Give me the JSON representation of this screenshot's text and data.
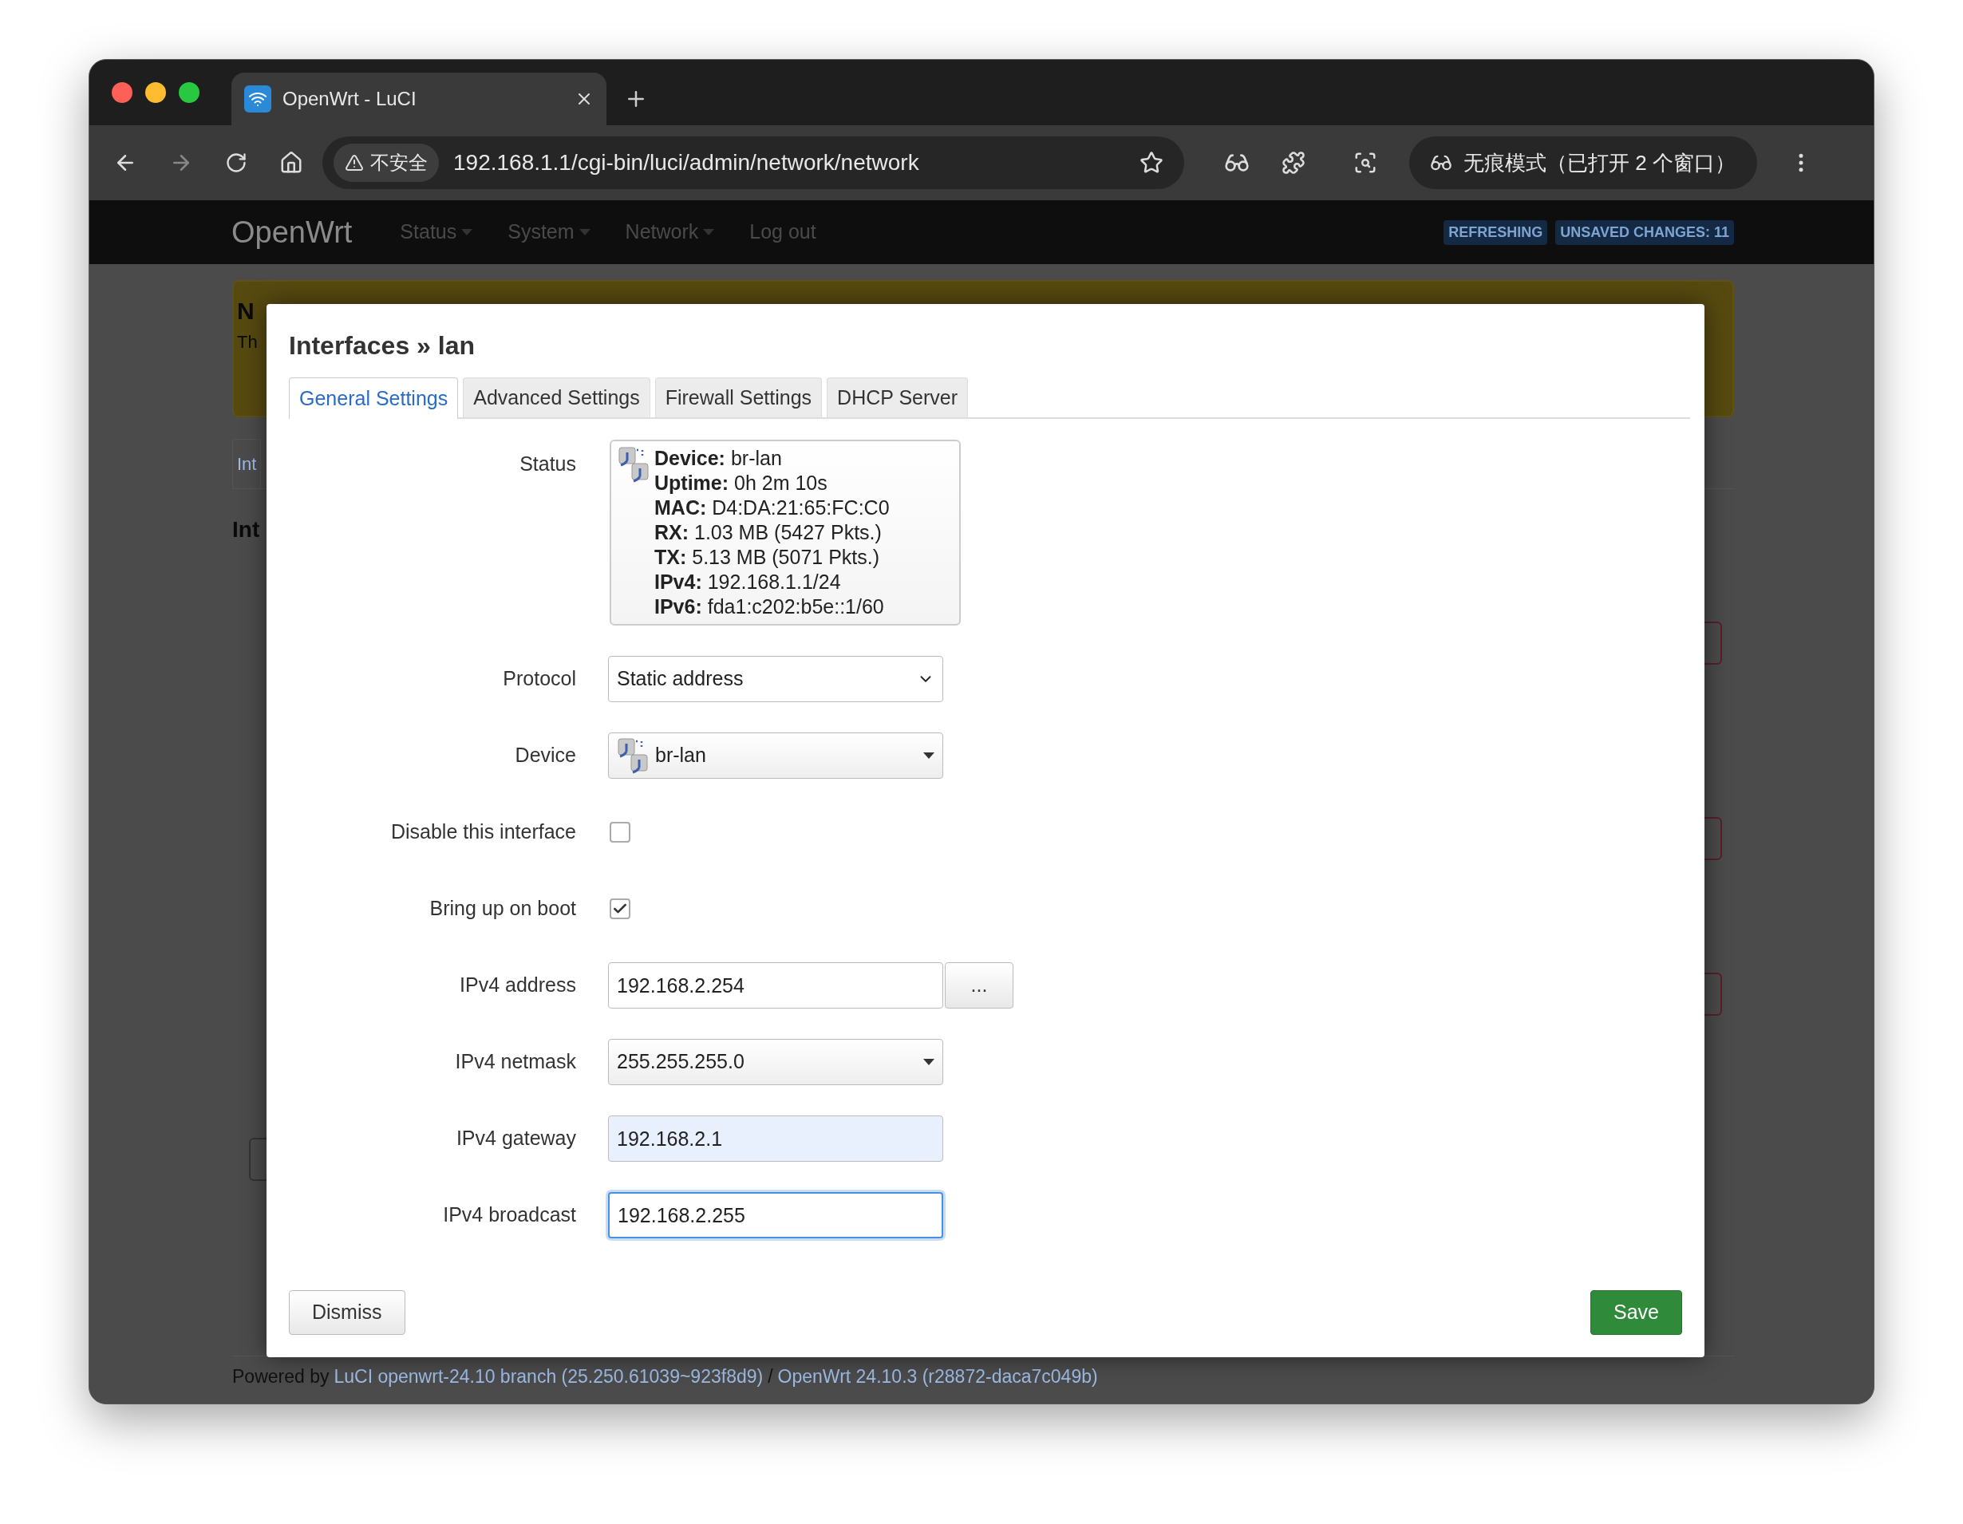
{
  "browser": {
    "tab_title": "OpenWrt - LuCI",
    "security_label": "不安全",
    "url": "192.168.1.1/cgi-bin/luci/admin/network/network",
    "profile_label": "无痕模式（已打开 2 个窗口）"
  },
  "navbar": {
    "brand": "OpenWrt",
    "menu": [
      {
        "label": "Status",
        "kind": "dropdown"
      },
      {
        "label": "System",
        "kind": "dropdown"
      },
      {
        "label": "Network",
        "kind": "dropdown"
      },
      {
        "label": "Log out",
        "kind": "link"
      }
    ],
    "badges": [
      "REFRESHING",
      "UNSAVED CHANGES: 11"
    ]
  },
  "background_page": {
    "notice_title": "N",
    "notice_text": "Th",
    "tab_link": "Int",
    "heading": "Int"
  },
  "modal": {
    "title": "Interfaces » lan",
    "tabs": [
      {
        "label": "General Settings",
        "selected": true
      },
      {
        "label": "Advanced Settings",
        "selected": false
      },
      {
        "label": "Firewall Settings",
        "selected": false
      },
      {
        "label": "DHCP Server",
        "selected": false
      }
    ],
    "status": {
      "label": "Status",
      "lines": [
        {
          "key": "Device:",
          "value": "br-lan"
        },
        {
          "key": "Uptime:",
          "value": "0h 2m 10s"
        },
        {
          "key": "MAC:",
          "value": "D4:DA:21:65:FC:C0"
        },
        {
          "key": "RX:",
          "value": "1.03 MB (5427 Pkts.)"
        },
        {
          "key": "TX:",
          "value": "5.13 MB (5071 Pkts.)"
        },
        {
          "key": "IPv4:",
          "value": "192.168.1.1/24"
        },
        {
          "key": "IPv6:",
          "value": "fda1:c202:b5e::1/60"
        }
      ]
    },
    "fields": [
      {
        "label": "Protocol",
        "kind": "select",
        "value": "Static address"
      },
      {
        "label": "Device",
        "kind": "device-combo",
        "value": "br-lan"
      },
      {
        "label": "Disable this interface",
        "kind": "checkbox",
        "checked": false
      },
      {
        "label": "Bring up on boot",
        "kind": "checkbox",
        "checked": true
      },
      {
        "label": "IPv4 address",
        "kind": "input-with-button",
        "value": "192.168.2.254",
        "button_label": "...",
        "autofilled": false,
        "focused": false
      },
      {
        "label": "IPv4 netmask",
        "kind": "combo",
        "value": "255.255.255.0"
      },
      {
        "label": "IPv4 gateway",
        "kind": "input",
        "value": "192.168.2.1",
        "autofilled": true,
        "focused": false
      },
      {
        "label": "IPv4 broadcast",
        "kind": "input",
        "value": "192.168.2.255",
        "autofilled": false,
        "focused": true
      }
    ],
    "buttons": [
      {
        "label": "Dismiss",
        "kind": "secondary"
      },
      {
        "label": "Save",
        "kind": "primary"
      }
    ]
  },
  "footer": [
    {
      "text": "Powered by",
      "kind": "text"
    },
    {
      "text": "LuCI openwrt-24.10 branch (25.250.61039~923f8d9)",
      "kind": "link"
    },
    {
      "text": "/",
      "kind": "text"
    },
    {
      "text": "OpenWrt 24.10.3 (r28872-daca7c049b)",
      "kind": "link"
    }
  ]
}
